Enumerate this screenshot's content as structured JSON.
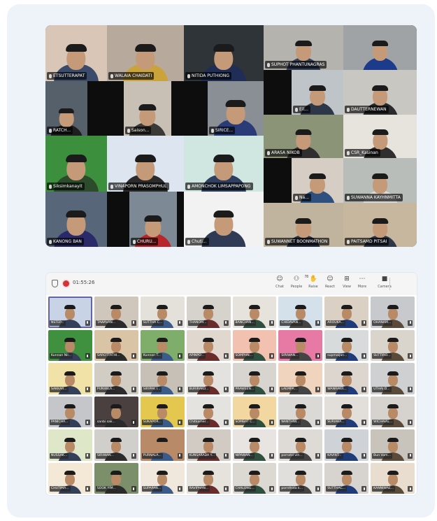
{
  "meeting_top": {
    "tiles": [
      {
        "name": "ETSUTTERAPAT",
        "bg": "#d9c6b6",
        "shirt": "#3a4a6a"
      },
      {
        "name": "WALAIA CHAIDATI",
        "bg": "#b7a99c",
        "shirt": "#caa43a"
      },
      {
        "name": "NITIDA PUTHIONG",
        "bg": "#2f3438",
        "shirt": "#1f2d57"
      },
      {
        "name": "SUPHOT PHANTUNAGRAS",
        "bg": "#b5b3ae",
        "shirt": "#37425a"
      },
      {
        "name": "",
        "bg": "#9fa3a6",
        "shirt": "#1c3b8a"
      },
      {
        "name": "RATCH...",
        "bg": "#56606a",
        "shirt": "#1e1e1e"
      },
      {
        "name": "Saison...",
        "bg": "#c8c0b4",
        "shirt": "#3c3a36"
      },
      {
        "name": "SIRICE...",
        "bg": "#8a8f95",
        "shirt": "#2a3c78"
      },
      {
        "name": "Eil...",
        "bg": "#bfc4c9",
        "shirt": "#2d3748"
      },
      {
        "name": "DAUTTERNEWAN",
        "bg": "#c9c7c1",
        "shirt": "#2b2b2b"
      },
      {
        "name": "ARASA NIKOB",
        "bg": "#8c9478",
        "shirt": "#2f2f2f"
      },
      {
        "name": "CSR_Kasinan",
        "bg": "#e7e3dd",
        "shirt": "#2f2f2f"
      },
      {
        "name": "Siksimkanayit",
        "bg": "#3c8f3c",
        "shirt": "#2b4b2b"
      },
      {
        "name": "VINAPORN PRASOMPHUL",
        "bg": "#dde5f0",
        "shirt": "#2b2b2b"
      },
      {
        "name": "AMONCHOK LIMSAPPAPONG",
        "bg": "#cfe7e0",
        "shirt": "#2f3f5f"
      },
      {
        "name": "Na...",
        "bg": "#d6cec4",
        "shirt": "#2f4f7f"
      },
      {
        "name": "SUWANNA KAYHNMITTA",
        "bg": "#b8bdb9",
        "shirt": "#d9d9d9"
      },
      {
        "name": "KANONG BAN",
        "bg": "#58667a",
        "shirt": "#2a2a6a"
      },
      {
        "name": "CHURU...",
        "bg": "#7d8a96",
        "shirt": "#b8262b"
      },
      {
        "name": "Chuti...",
        "bg": "#f2f2f2",
        "shirt": "#2f3b55"
      },
      {
        "name": "SUWANNET BOONMATHON",
        "bg": "#c1b49f",
        "shirt": "#2b3344"
      },
      {
        "name": "PAITSAMD PITSAI",
        "bg": "#c7b79f",
        "shirt": "#2d3748"
      }
    ]
  },
  "meeting_bottom": {
    "toolbar": {
      "timer": "01:55:26",
      "buttons": [
        {
          "icon": "☺",
          "label": "Chat"
        },
        {
          "icon": "⚇",
          "label": "People",
          "count": "78"
        },
        {
          "icon": "✋",
          "label": "Raise"
        },
        {
          "icon": "☺",
          "label": "React"
        },
        {
          "icon": "⊞",
          "label": "View"
        },
        {
          "icon": "⋯",
          "label": "More"
        },
        {
          "icon": "■",
          "label": "Camera"
        }
      ]
    },
    "tiles": [
      {
        "name": "NSTEP...",
        "bg": "#c8d4e6"
      },
      {
        "name": "TAWAVAN...",
        "bg": "#cfc6bc"
      },
      {
        "name": "SUTTHA C...",
        "bg": "#e4e1db"
      },
      {
        "name": "THANOM...",
        "bg": "#d6d2cc"
      },
      {
        "name": "BANCHAN...",
        "bg": "#e6e2dc"
      },
      {
        "name": "CHIDAVAN...",
        "bg": "#d4e0ea"
      },
      {
        "name": "AROUKA...",
        "bg": "#dad0c4"
      },
      {
        "name": "OHANAM...",
        "bg": "#c7c9cc"
      },
      {
        "name": "Kunnan Nil...",
        "bg": "#3f9140"
      },
      {
        "name": "SAROTTATHI...",
        "bg": "#d9c5a5"
      },
      {
        "name": "Kunnan T...",
        "bg": "#7fae6a"
      },
      {
        "name": "APINPO...",
        "bg": "#e0d8cf"
      },
      {
        "name": "SOMPHN...",
        "bg": "#f3c1b0"
      },
      {
        "name": "SIRIWAN...",
        "bg": "#e67aa4"
      },
      {
        "name": "supmaijan...",
        "bg": "#d8dbdc"
      },
      {
        "name": "SUTTIRO...",
        "bg": "#dad5cc"
      },
      {
        "name": "SAKKAR...",
        "bg": "#f1e2a8"
      },
      {
        "name": "PUNWILA...",
        "bg": "#d1cdc5"
      },
      {
        "name": "SIRIPAK I...",
        "bg": "#c7c0b6"
      },
      {
        "name": "BURIRAKO...",
        "bg": "#e4e2de"
      },
      {
        "name": "PRAWEEN...",
        "bg": "#d8d5d0"
      },
      {
        "name": "LAEMPA...",
        "bg": "#f0d4bd"
      },
      {
        "name": "WANRAKR...",
        "bg": "#dcd6cf"
      },
      {
        "name": "UTHAI D...",
        "bg": "#cfd0d2"
      },
      {
        "name": "PANICHA...",
        "bg": "#c4c6c9"
      },
      {
        "name": "sanbi sak...",
        "bg": "#4a4040"
      },
      {
        "name": "SUKAPOR...",
        "bg": "#e3c74e"
      },
      {
        "name": "Chitkamer...",
        "bg": "#e5e3e0"
      },
      {
        "name": "SOMBAT C...",
        "bg": "#f2d7a1"
      },
      {
        "name": "NANTHIW...",
        "bg": "#dbd9d6"
      },
      {
        "name": "SURIAKA...",
        "bg": "#e2dfdb"
      },
      {
        "name": "WICHAIAL...",
        "bg": "#d6d3cf"
      },
      {
        "name": "NUSSAK...",
        "bg": "#dfe7c9"
      },
      {
        "name": "SIRIWAN...",
        "bg": "#d1cfcb"
      },
      {
        "name": "PURNALA...",
        "bg": "#b98a68"
      },
      {
        "name": "KUNSARADA Y...",
        "bg": "#d2cbc4"
      },
      {
        "name": "NIPAWAN...",
        "bg": "#e7e4e1"
      },
      {
        "name": "pornstd vih...",
        "bg": "#dedbd7"
      },
      {
        "name": "KAVINT...",
        "bg": "#cfd3d8"
      },
      {
        "name": "Bun Vom...",
        "bg": "#c8c3bb"
      },
      {
        "name": "CHUTIMA...",
        "bg": "#f4e9d6"
      },
      {
        "name": "SOOK YIM...",
        "bg": "#7a8f6a"
      },
      {
        "name": "SUPAPAN...",
        "bg": "#f0e8dd"
      },
      {
        "name": "RAVIPHAN...",
        "bg": "#e6e2dc"
      },
      {
        "name": "CHALONG...",
        "bg": "#dcd8d2"
      },
      {
        "name": "pornthida k...",
        "bg": "#e1dfdb"
      },
      {
        "name": "SUTTHAC...",
        "bg": "#d7d3ce"
      },
      {
        "name": "KANNIWAE...",
        "bg": "#e9ddd0"
      }
    ]
  }
}
